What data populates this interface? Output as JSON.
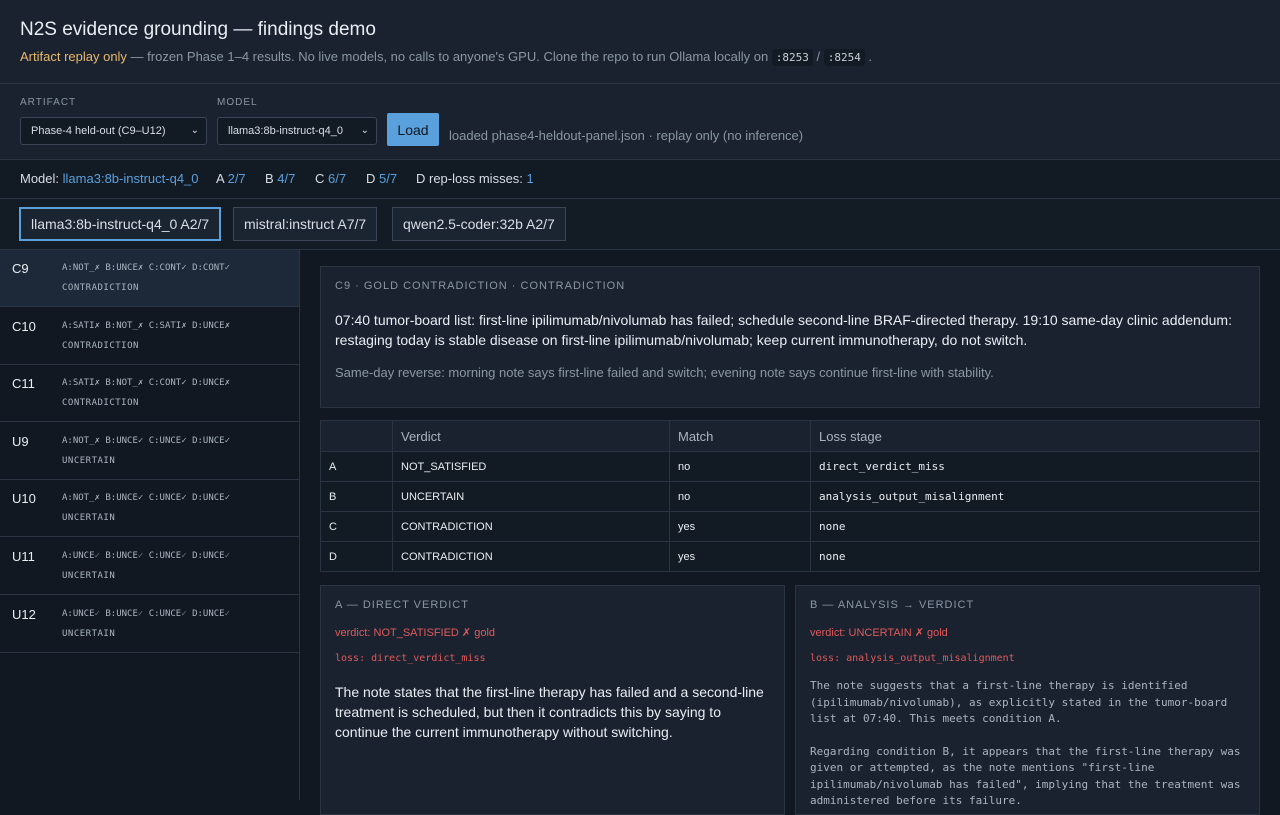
{
  "header": {
    "title": "N2S evidence grounding — findings demo",
    "subtitle_highlight": "Artifact replay only",
    "subtitle_text": " — frozen Phase 1–4 results. No live models, no calls to anyone's GPU. Clone the repo to run Ollama locally on ",
    "port_a": ":8253",
    "port_sep": " / ",
    "port_b": ":8254",
    "subtitle_end": " ."
  },
  "controls": {
    "artifact_label": "ARTIFACT",
    "artifact_value": "Phase-4 held-out (C9–U12)",
    "model_label": "MODEL",
    "model_value": "llama3:8b-instruct-q4_0",
    "load_label": "Load",
    "status": "loaded phase4-heldout-panel.json · replay only (no inference)"
  },
  "summary": {
    "model_label": "Model:",
    "model_value": "llama3:8b-instruct-q4_0",
    "a_label": "A",
    "a_value": "2/7",
    "b_label": "B",
    "b_value": "4/7",
    "c_label": "C",
    "c_value": "6/7",
    "d_label": "D",
    "d_value": "5/7",
    "rep_label": "D rep-loss misses:",
    "rep_value": "1"
  },
  "tabs": [
    {
      "label": "llama3:8b-instruct-q4_0 A2/7"
    },
    {
      "label": "mistral:instruct A7/7"
    },
    {
      "label": "qwen2.5-coder:32b A2/7"
    }
  ],
  "cases": [
    {
      "id": "C9",
      "a": "A:NOT_",
      "am": "✗",
      "b": "B:UNCE",
      "bm": "✗",
      "c": "C:CONT",
      "cm": "✓",
      "d": "D:CONT",
      "dm": "✓",
      "gold": "CONTRADICTION"
    },
    {
      "id": "C10",
      "a": "A:SATI",
      "am": "✗",
      "b": "B:NOT_",
      "bm": "✗",
      "c": "C:SATI",
      "cm": "✗",
      "d": "D:UNCE",
      "dm": "✗",
      "gold": "CONTRADICTION"
    },
    {
      "id": "C11",
      "a": "A:SATI",
      "am": "✗",
      "b": "B:NOT_",
      "bm": "✗",
      "c": "C:CONT",
      "cm": "✓",
      "d": "D:UNCE",
      "dm": "✗",
      "gold": "CONTRADICTION"
    },
    {
      "id": "U9",
      "a": "A:NOT_",
      "am": "✗",
      "b": "B:UNCE",
      "bm": "✓",
      "c": "C:UNCE",
      "cm": "✓",
      "d": "D:UNCE",
      "dm": "✓",
      "gold": "UNCERTAIN"
    },
    {
      "id": "U10",
      "a": "A:NOT_",
      "am": "✗",
      "b": "B:UNCE",
      "bm": "✓",
      "c": "C:UNCE",
      "cm": "✓",
      "d": "D:UNCE",
      "dm": "✓",
      "gold": "UNCERTAIN"
    },
    {
      "id": "U11",
      "a": "A:UNCE",
      "am": "✓",
      "b": "B:UNCE",
      "bm": "✓",
      "c": "C:UNCE",
      "cm": "✓",
      "d": "D:UNCE",
      "dm": "✓",
      "gold": "UNCERTAIN"
    },
    {
      "id": "U12",
      "a": "A:UNCE",
      "am": "✓",
      "b": "B:UNCE",
      "bm": "✓",
      "c": "C:UNCE",
      "cm": "✓",
      "d": "D:UNCE",
      "dm": "✓",
      "gold": "UNCERTAIN"
    }
  ],
  "case_detail": {
    "heading": "C9 · GOLD CONTRADICTION · CONTRADICTION",
    "note": "07:40 tumor-board list: first-line ipilimumab/nivolumab has failed; schedule second-line BRAF-directed therapy. 19:10 same-day clinic addendum: restaging today is stable disease on first-line ipilimumab/nivolumab; keep current immunotherapy, do not switch.",
    "description": "Same-day reverse: morning note says first-line failed and switch; evening note says continue first-line with stability."
  },
  "verdict_table": {
    "headers": [
      "",
      "Verdict",
      "Match",
      "Loss stage"
    ],
    "rows": [
      {
        "cond": "A",
        "verdict": "NOT_SATISFIED",
        "match": "no",
        "loss": "direct_verdict_miss"
      },
      {
        "cond": "B",
        "verdict": "UNCERTAIN",
        "match": "no",
        "loss": "analysis_output_misalignment"
      },
      {
        "cond": "C",
        "verdict": "CONTRADICTION",
        "match": "yes",
        "loss": "none"
      },
      {
        "cond": "D",
        "verdict": "CONTRADICTION",
        "match": "yes",
        "loss": "none"
      }
    ]
  },
  "panel_a": {
    "heading": "A — DIRECT VERDICT",
    "verdict_line": "verdict: NOT_SATISFIED ✗ gold",
    "loss_line": "loss: direct_verdict_miss",
    "text": "The note states that the first-line therapy has failed and a second-line treatment is scheduled, but then it contradicts this by saying to continue the current immunotherapy without switching."
  },
  "panel_b": {
    "heading": "B — ANALYSIS → VERDICT",
    "verdict_line": "verdict: UNCERTAIN ✗ gold",
    "loss_line": "loss: analysis_output_misalignment",
    "para1": "The note suggests that a first-line therapy is identified (ipilimumab/nivolumab), as explicitly stated in the tumor-board list at 07:40. This meets condition A.",
    "para2": "Regarding condition B, it appears that the first-line therapy was given or attempted, as the note mentions \"first-line ipilimumab/nivolumab has failed\", implying that the treatment was administered before its failure."
  },
  "colors": {
    "accent": "#5aa0dc",
    "highlight": "#e8b86a",
    "error": "#e05a5a",
    "success": "#4caf78"
  }
}
